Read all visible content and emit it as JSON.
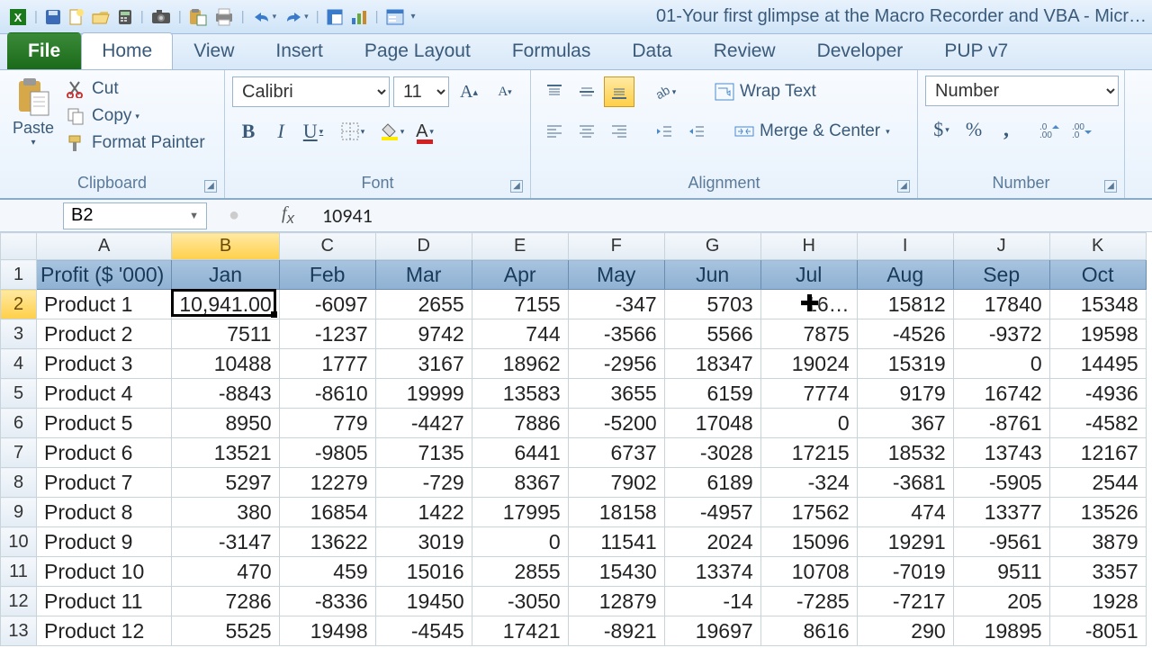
{
  "window": {
    "title": "01-Your first glimpse at the Macro Recorder and VBA  -  Micr…"
  },
  "tabs": [
    "File",
    "Home",
    "View",
    "Insert",
    "Page Layout",
    "Formulas",
    "Data",
    "Review",
    "Developer",
    "PUP v7"
  ],
  "active_tab": "Home",
  "ribbon": {
    "clipboard": {
      "label": "Clipboard",
      "paste": "Paste",
      "cut": "Cut",
      "copy": "Copy",
      "fp": "Format Painter"
    },
    "font": {
      "label": "Font",
      "name": "Calibri",
      "size": "11"
    },
    "alignment": {
      "label": "Alignment",
      "wrap": "Wrap Text",
      "merge": "Merge & Center"
    },
    "number": {
      "label": "Number",
      "format": "Number"
    }
  },
  "cell": {
    "name": "B2",
    "formula": "10941"
  },
  "columns": [
    "A",
    "B",
    "C",
    "D",
    "E",
    "F",
    "G",
    "H",
    "I",
    "J",
    "K"
  ],
  "col_widths": [
    "cA",
    "cB",
    "cC",
    "cD",
    "cE",
    "cF",
    "cG",
    "cH",
    "cI",
    "cJ",
    "cK"
  ],
  "headers": [
    "Profit ($ '000)",
    "Jan",
    "Feb",
    "Mar",
    "Apr",
    "May",
    "Jun",
    "Jul",
    "Aug",
    "Sep",
    "Oct"
  ],
  "rows": [
    {
      "n": 2,
      "c": [
        "Product 1",
        "10,941.00",
        "-6097",
        "2655",
        "7155",
        "-347",
        "5703",
        "16…",
        "15812",
        "17840",
        "15348"
      ]
    },
    {
      "n": 3,
      "c": [
        "Product 2",
        "7511",
        "-1237",
        "9742",
        "744",
        "-3566",
        "5566",
        "7875",
        "-4526",
        "-9372",
        "19598"
      ]
    },
    {
      "n": 4,
      "c": [
        "Product 3",
        "10488",
        "1777",
        "3167",
        "18962",
        "-2956",
        "18347",
        "19024",
        "15319",
        "0",
        "14495"
      ]
    },
    {
      "n": 5,
      "c": [
        "Product 4",
        "-8843",
        "-8610",
        "19999",
        "13583",
        "3655",
        "6159",
        "7774",
        "9179",
        "16742",
        "-4936"
      ]
    },
    {
      "n": 6,
      "c": [
        "Product 5",
        "8950",
        "779",
        "-4427",
        "7886",
        "-5200",
        "17048",
        "0",
        "367",
        "-8761",
        "-4582"
      ]
    },
    {
      "n": 7,
      "c": [
        "Product 6",
        "13521",
        "-9805",
        "7135",
        "6441",
        "6737",
        "-3028",
        "17215",
        "18532",
        "13743",
        "12167"
      ]
    },
    {
      "n": 8,
      "c": [
        "Product 7",
        "5297",
        "12279",
        "-729",
        "8367",
        "7902",
        "6189",
        "-324",
        "-3681",
        "-5905",
        "2544"
      ]
    },
    {
      "n": 9,
      "c": [
        "Product 8",
        "380",
        "16854",
        "1422",
        "17995",
        "18158",
        "-4957",
        "17562",
        "474",
        "13377",
        "13526"
      ]
    },
    {
      "n": 10,
      "c": [
        "Product 9",
        "-3147",
        "13622",
        "3019",
        "0",
        "11541",
        "2024",
        "15096",
        "19291",
        "-9561",
        "3879"
      ]
    },
    {
      "n": 11,
      "c": [
        "Product 10",
        "470",
        "459",
        "15016",
        "2855",
        "15430",
        "13374",
        "10708",
        "-7019",
        "9511",
        "3357"
      ]
    },
    {
      "n": 12,
      "c": [
        "Product 11",
        "7286",
        "-8336",
        "19450",
        "-3050",
        "12879",
        "-14",
        "-7285",
        "-7217",
        "205",
        "1928"
      ]
    },
    {
      "n": 13,
      "c": [
        "Product 12",
        "5525",
        "19498",
        "-4545",
        "17421",
        "-8921",
        "19697",
        "8616",
        "290",
        "19895",
        "-8051"
      ]
    }
  ],
  "active": {
    "row": 2,
    "col": 1
  },
  "cursor_overlay": {
    "row": 2,
    "col": 7
  }
}
